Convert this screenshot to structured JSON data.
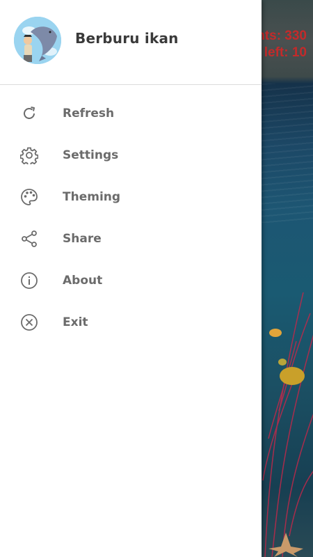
{
  "app": {
    "title": "Berburu ikan"
  },
  "game": {
    "score_line1": "nts: 330",
    "score_line2": "left: 10"
  },
  "menu": {
    "items": [
      {
        "label": "Refresh",
        "icon": "refresh-icon"
      },
      {
        "label": "Settings",
        "icon": "gear-icon"
      },
      {
        "label": "Theming",
        "icon": "palette-icon"
      },
      {
        "label": "Share",
        "icon": "share-icon"
      },
      {
        "label": "About",
        "icon": "info-icon"
      },
      {
        "label": "Exit",
        "icon": "close-circle-icon"
      }
    ]
  },
  "colors": {
    "score_text": "#c42a2a",
    "menu_label": "#6b6b6b",
    "icon": "#6b6b6b",
    "drawer_bg": "#ffffff"
  }
}
